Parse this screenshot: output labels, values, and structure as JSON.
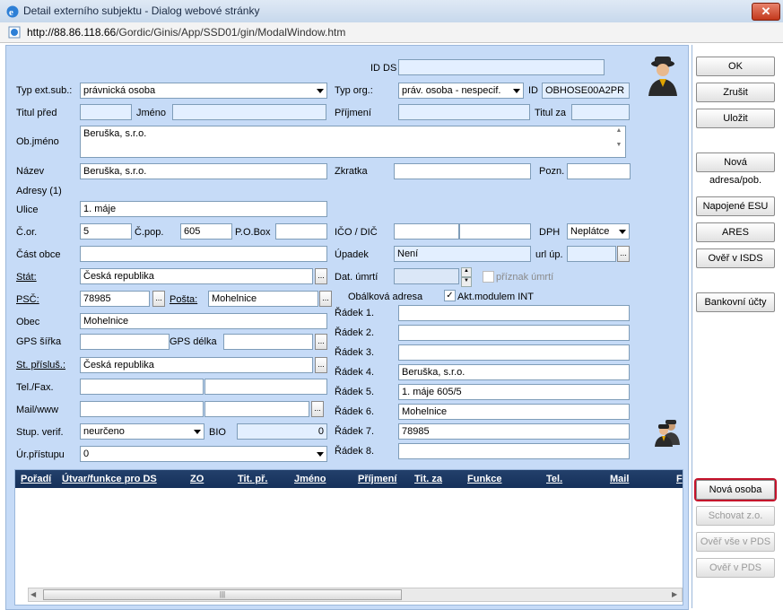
{
  "window": {
    "title": "Detail externího subjektu - Dialog webové stránky",
    "close": "✕"
  },
  "url": {
    "host": "http://88.86.118.66",
    "path": "/Gordic/Ginis/App/SSD01/gin/ModalWindow.htm"
  },
  "form": {
    "id_ds_label": "ID DS",
    "id_ds_value": "",
    "typ_ext_label": "Typ ext.sub.:",
    "typ_ext_value": "právnická osoba",
    "typ_org_label": "Typ org.:",
    "typ_org_value": "práv. osoba - nespecif.",
    "id_label": "ID",
    "id_value": "OBHOSE00A2PR",
    "titul_pred_label": "Titul před",
    "jmeno_label": "Jméno",
    "prijmeni_label": "Příjmení",
    "titul_za_label": "Titul za",
    "objmeno_label": "Ob.jméno",
    "objmeno_value": "Beruška, s.r.o.",
    "nazev_label": "Název",
    "nazev_value": "Beruška, s.r.o.",
    "zkratka_label": "Zkratka",
    "pozn_label": "Pozn.",
    "adresy_label": "Adresy (1)",
    "ulice_label": "Ulice",
    "ulice_value": "1. máje",
    "cor_label": "Č.or.",
    "cor_value": "5",
    "cpop_label": "Č.pop.",
    "cpop_value": "605",
    "pobox_label": "P.O.Box",
    "ico_label": "IČO / DIČ",
    "dph_label": "DPH",
    "dph_value": "Neplátce",
    "cast_obce_label": "Část obce",
    "upadek_label": "Úpadek",
    "upadek_value": "Není",
    "url_label": "url úp.",
    "stat_label": "Stát:",
    "stat_value": "Česká republika",
    "dat_umrti_label": "Dat. úmrtí",
    "priznak_label": "příznak úmrtí",
    "psc_label": "PSČ:",
    "psc_value": "78985",
    "posta_label": "Pošta:",
    "posta_value": "Mohelnice",
    "obalkova_label": "Obálková adresa",
    "akt_label": "Akt.modulem INT",
    "akt_checked": "✓",
    "obec_label": "Obec",
    "obec_value": "Mohelnice",
    "gps_sirka_label": "GPS šířka",
    "gps_delka_label": "GPS délka",
    "st_prislus_label": "St. přísluš.:",
    "st_prislus_value": "Česká republika",
    "tel_label": "Tel./Fax.",
    "mail_label": "Mail/www",
    "stup_label": "Stup. verif.",
    "stup_value": "neurčeno",
    "bio_label": "BIO",
    "bio_value": "0",
    "ur_label": "Úr.přístupu",
    "ur_value": "0",
    "radky": [
      {
        "label": "Řádek 1.",
        "value": ""
      },
      {
        "label": "Řádek 2.",
        "value": ""
      },
      {
        "label": "Řádek 3.",
        "value": ""
      },
      {
        "label": "Řádek 4.",
        "value": "Beruška, s.r.o."
      },
      {
        "label": "Řádek 5.",
        "value": "1. máje 605/5"
      },
      {
        "label": "Řádek 6.",
        "value": "Mohelnice"
      },
      {
        "label": "Řádek 7.",
        "value": "78985"
      },
      {
        "label": "Řádek 8.",
        "value": ""
      }
    ]
  },
  "grid": {
    "columns": [
      "Pořadí",
      "Útvar/funkce pro DS",
      "ZO",
      "Tit. př.",
      "Jméno",
      "Příjmení",
      "Tit. za",
      "Funkce",
      "Tel.",
      "Mail",
      "F"
    ],
    "scroll_grip": "|||"
  },
  "buttons": {
    "ok": "OK",
    "zrusit": "Zrušit",
    "ulozit": "Uložit",
    "nova_adresa": "Nová adresa/pob.",
    "napojene_esu": "Napojené ESU",
    "ares": "ARES",
    "over_isds": "Ověř v ISDS",
    "bankovni": "Bankovní účty",
    "nova_osoba": "Nová osoba",
    "schovat": "Schovat z.o.",
    "over_vse": "Ověř vše v PDS",
    "over_pds": "Ověř v PDS"
  },
  "icons": {
    "browser": "ie-icon",
    "page": "page-icon",
    "person": "person-icon",
    "persons": "persons-icon"
  }
}
